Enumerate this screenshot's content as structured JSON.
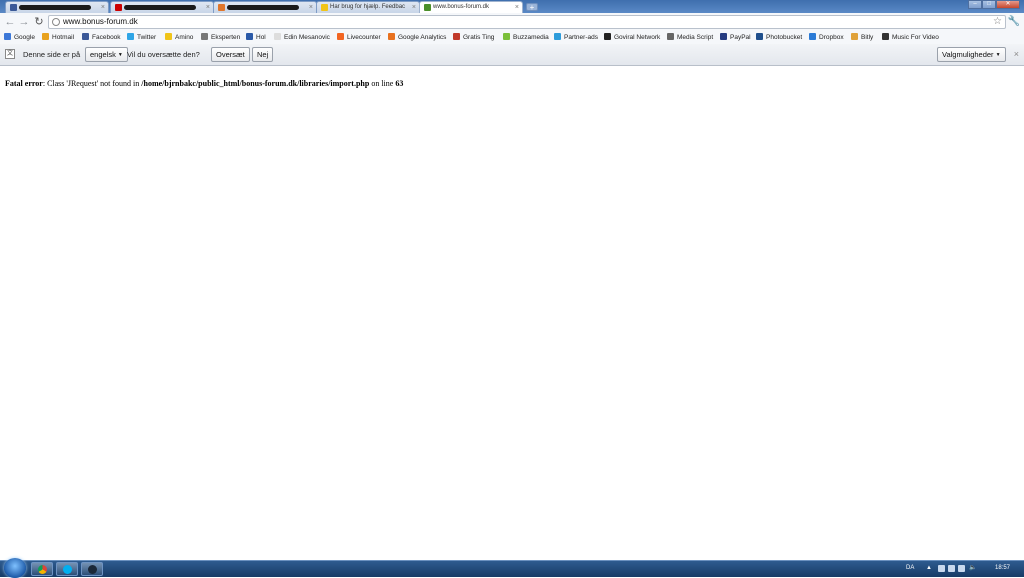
{
  "browser": {
    "tabs": [
      {
        "title": "",
        "redacted": true,
        "favicon_color": "#3b5998"
      },
      {
        "title": "",
        "redacted": true,
        "favicon_color": "#cc0000"
      },
      {
        "title": "",
        "redacted": true,
        "favicon_color": "#e0762b"
      },
      {
        "title": "Har brug for hjælp. Feedbac",
        "redacted": false,
        "favicon_color": "#f0c419"
      },
      {
        "title": "www.bonus-forum.dk",
        "redacted": false,
        "favicon_color": "#4a8f2a",
        "active": true
      }
    ],
    "url": "www.bonus-forum.dk"
  },
  "bookmarks": [
    {
      "label": "Google",
      "icon": "google-icon",
      "color": "#3c78d8"
    },
    {
      "label": "Hotmail",
      "icon": "hotmail-icon",
      "color": "#e8a21f"
    },
    {
      "label": "Facebook",
      "icon": "facebook-icon",
      "color": "#3b5998"
    },
    {
      "label": "Twitter",
      "icon": "twitter-icon",
      "color": "#2fa5e6"
    },
    {
      "label": "Amino",
      "icon": "bulb-icon",
      "color": "#f0c419"
    },
    {
      "label": "Eksperten",
      "icon": "eksperten-icon",
      "color": "#777777"
    },
    {
      "label": "Hol",
      "icon": "hol-icon",
      "color": "#2b5aa8"
    },
    {
      "label": "Edin Mesanovic",
      "icon": "page-icon",
      "color": "#dddddd"
    },
    {
      "label": "Livecounter",
      "icon": "livecounter-icon",
      "color": "#f26522"
    },
    {
      "label": "Google Analytics",
      "icon": "analytics-icon",
      "color": "#e8711f"
    },
    {
      "label": "Gratis Ting",
      "icon": "gratis-icon",
      "color": "#c0392b"
    },
    {
      "label": "Buzzamedia",
      "icon": "buzzamedia-icon",
      "color": "#7bbf3a"
    },
    {
      "label": "Partner-ads",
      "icon": "partnerads-icon",
      "color": "#2d9cdb"
    },
    {
      "label": "Goviral Network",
      "icon": "goviral-icon",
      "color": "#222222"
    },
    {
      "label": "Media Script",
      "icon": "mediascript-icon",
      "color": "#666666"
    },
    {
      "label": "PayPal",
      "icon": "paypal-icon",
      "color": "#253b80"
    },
    {
      "label": "Photobucket",
      "icon": "photobucket-icon",
      "color": "#1f4f8c"
    },
    {
      "label": "Dropbox",
      "icon": "dropbox-icon",
      "color": "#2b7bd6"
    },
    {
      "label": "Bitly",
      "icon": "bitly-icon",
      "color": "#e0a23a"
    },
    {
      "label": "Music For Video",
      "icon": "music-icon",
      "color": "#333333"
    }
  ],
  "translate_bar": {
    "prefix": "Denne side er på",
    "language": "engelsk",
    "question": "Vil du oversætte den?",
    "translate_button": "Oversæt",
    "no_button": "Nej",
    "options_button": "Valgmuligheder"
  },
  "error": {
    "label": "Fatal error",
    "message_start": ": Class 'JRequest' not found in ",
    "path": "/home/bjrnbakc/public_html/bonus-forum.dk/libraries/import.php",
    "on_line": " on line ",
    "line": "63"
  },
  "taskbar": {
    "language": "DA",
    "clock": "18:57"
  }
}
